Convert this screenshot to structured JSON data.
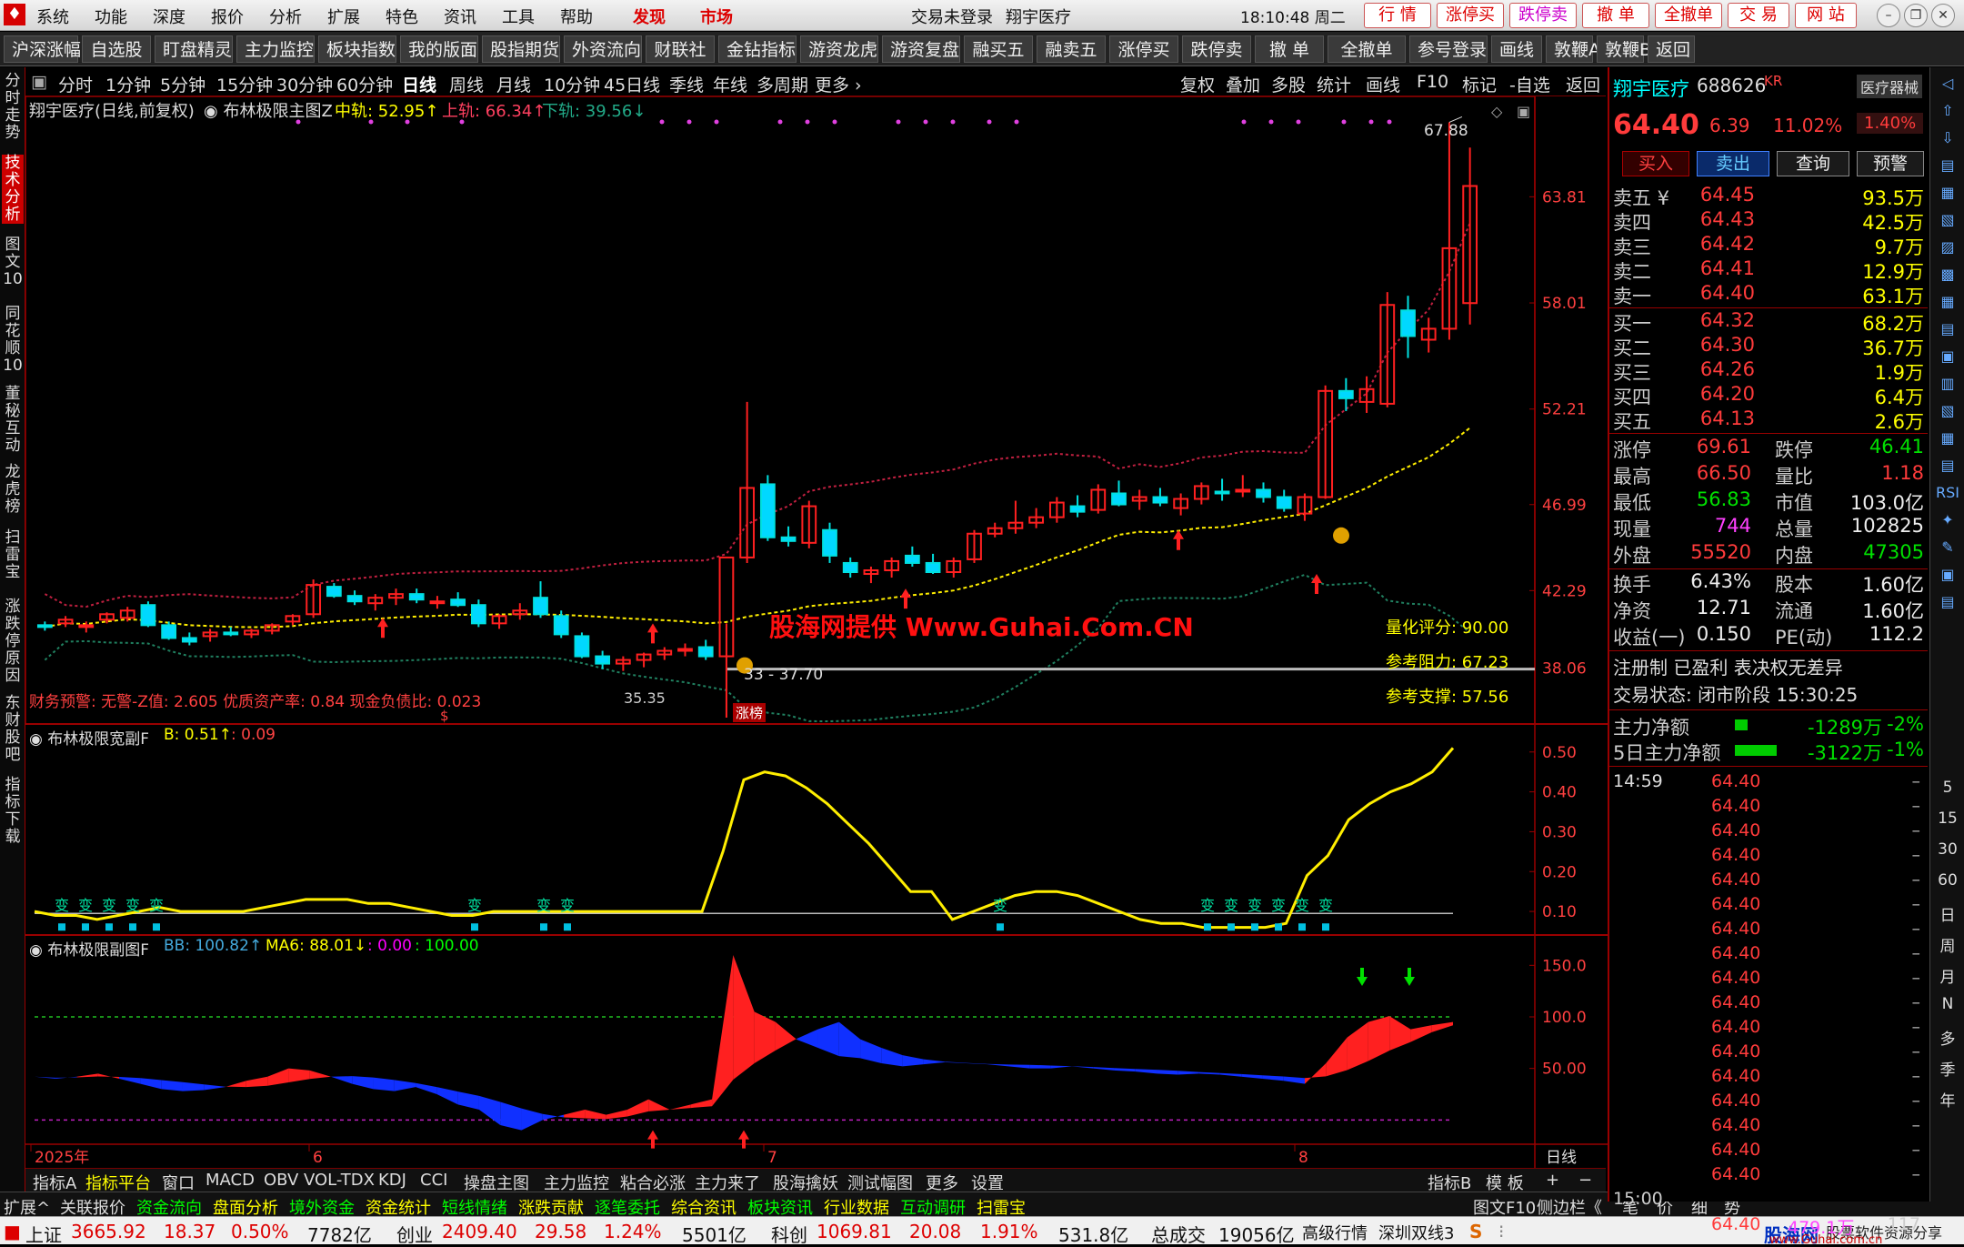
{
  "topbar": {
    "menus": [
      "系统",
      "功能",
      "深度",
      "报价",
      "分析",
      "扩展",
      "特色",
      "资讯",
      "工具",
      "帮助"
    ],
    "discover": "发现",
    "market": "市场",
    "login_status": "交易未登录",
    "stock_name": "翔宇医疗",
    "clock": "18:10:48 周二",
    "buttons": [
      "行 情",
      "涨停买",
      "跌停卖",
      "撤 单",
      "全撤单",
      "交 易",
      "网 站"
    ]
  },
  "toolbar": [
    "沪深涨幅",
    "自选股",
    "盯盘精灵",
    "主力监控",
    "板块指数",
    "我的版面",
    "股指期货",
    "外资流向",
    "财联社",
    "金钻指标",
    "游资龙虎",
    "游资复盘",
    "融买五",
    "融卖五",
    "涨停买",
    "跌停卖",
    "撤 单",
    "全撤单",
    "参号登录",
    "画线",
    "敦鞭A",
    "敦鞭B",
    "返回"
  ],
  "left_tabs": [
    "分时走势",
    "技术分析",
    "图文10",
    "同花顺10",
    "董秘互动",
    "龙虎榜",
    "扫雷宝",
    "涨跌停原因",
    "东财股吧",
    "指标下载"
  ],
  "periods": [
    "分时",
    "1分钟",
    "5分钟",
    "15分钟",
    "30分钟",
    "60分钟",
    "日线",
    "周线",
    "月线",
    "10分钟",
    "45日线",
    "季线",
    "年线",
    "多周期",
    "更多 ›"
  ],
  "active_period": "日线",
  "period_right": [
    "复权",
    "叠加",
    "多股",
    "统计",
    "画线",
    "F10",
    "标记",
    "-自选",
    "返回"
  ],
  "main_chart": {
    "title": "翔宇医疗(日线,前复权)",
    "indicator": "布林极限主图Z",
    "mid_label": "中轨: 52.95↑",
    "upper_label": "上轨: 66.34↑",
    "lower_label": "下轨: 39.56↓",
    "y_ticks": [
      "63.81",
      "58.01",
      "52.21",
      "46.99",
      "42.29",
      "38.06"
    ],
    "annot_high": "67.88",
    "annot_low": "35.35",
    "annot_range": "33 - 37.70",
    "zhangting": "涨榜",
    "watermark": "股海网提供 Www.Guhai.Com.CN",
    "score": "量化评分: 90.00",
    "resistance": "参考阻力: 67.23",
    "support": "参考支撑: 57.56",
    "finance_warning": "财务预警: 无警-Z值: 2.605 优质资产率: 0.84 现金负债比: 0.023",
    "dollar": "$"
  },
  "sub1": {
    "title": "布林极限宽副F",
    "b_label": "B: 0.51↑",
    "extra": ": 0.09",
    "y_ticks": [
      "0.50",
      "0.40",
      "0.30",
      "0.20",
      "0.10"
    ],
    "tag": "变"
  },
  "sub2": {
    "title": "布林极限副图F",
    "bb_label": "BB: 100.82↑",
    "ma6_label": "MA6: 88.01↓",
    "extra1": ": 0.00",
    "extra2": ": 100.00",
    "y_ticks": [
      "150.0",
      "100.0",
      "50.00"
    ]
  },
  "x_axis": {
    "labels": [
      "2025年",
      "6",
      "7",
      "8"
    ],
    "right": "日线"
  },
  "bottom_tabs": [
    "指标A",
    "指标平台",
    "窗口",
    "MACD",
    "OBV",
    "VOL-TDX",
    "KDJ",
    "CCI",
    "操盘主图",
    "主力监控",
    "粘合必涨",
    "主力来了",
    "股海擒妖",
    "测试幅图",
    "更多",
    "设置"
  ],
  "bottom_right": [
    "指标B",
    "模 板",
    "+",
    "−"
  ],
  "status_row1": [
    "扩展^",
    "关联报价",
    "资金流向",
    "盘面分析",
    "境外资金",
    "资金统计",
    "短线情绪",
    "涨跌贡献",
    "逐笔委托",
    "综合资讯",
    "板块资讯",
    "行业数据",
    "互动调研",
    "扫雷宝"
  ],
  "status_row1_right": [
    "图文F10",
    "侧边栏《",
    "笔",
    "价",
    "细",
    "势"
  ],
  "status_row2": {
    "sh_label": "上证",
    "sh_val": "3665.92",
    "sh_chg": "18.37",
    "sh_pct": "0.50%",
    "sh_amt": "7782亿",
    "cy_label": "创业",
    "cy_val": "2409.40",
    "cy_chg": "29.58",
    "cy_pct": "1.24%",
    "cy_amt": "5501亿",
    "kc_label": "科创",
    "kc_val": "1069.81",
    "kc_chg": "20.08",
    "kc_pct": "1.91%",
    "kc_amt": "531.8亿",
    "total_label": "总成交",
    "total_val": "19056亿",
    "hq": "高级行情",
    "sz": "深圳双线3",
    "site": "股海网",
    "site_desc": "股票软件资源分享",
    "site_url": "www.Guhai.com.cn"
  },
  "quote": {
    "name": "翔宇医疗",
    "code": "688626",
    "flag": "KR",
    "sector": "医疗器械",
    "price": "64.40",
    "chg": "6.39",
    "pct": "11.02%",
    "sector_pct": "1.40%",
    "actions": [
      "买入",
      "卖出",
      "查询",
      "预警"
    ],
    "sells": [
      [
        "卖五 ¥",
        "64.45",
        "93.5万"
      ],
      [
        "卖四",
        "64.43",
        "42.5万"
      ],
      [
        "卖三",
        "64.42",
        "9.7万"
      ],
      [
        "卖二",
        "64.41",
        "12.9万"
      ],
      [
        "卖一",
        "64.40",
        "63.1万"
      ]
    ],
    "buys": [
      [
        "买一",
        "64.32",
        "68.2万"
      ],
      [
        "买二",
        "64.30",
        "36.7万"
      ],
      [
        "买三",
        "64.26",
        "1.9万"
      ],
      [
        "买四",
        "64.20",
        "6.4万"
      ],
      [
        "买五",
        "64.13",
        "2.6万"
      ]
    ],
    "stats": [
      [
        "涨停",
        "69.61",
        "跌停",
        "46.41"
      ],
      [
        "最高",
        "66.50",
        "量比",
        "1.18"
      ],
      [
        "最低",
        "56.83",
        "市值",
        "103.0亿"
      ],
      [
        "现量",
        "744",
        "总量",
        "102825"
      ],
      [
        "外盘",
        "55520",
        "内盘",
        "47305"
      ],
      [
        "换手",
        "6.43%",
        "股本",
        "1.60亿"
      ],
      [
        "净资",
        "12.71",
        "流通",
        "1.60亿"
      ],
      [
        "收益(一)",
        "0.150",
        "PE(动)",
        "112.2"
      ]
    ],
    "reg": "注册制 已盈利 表决权无差异",
    "trade_state": "交易状态: 闭市阶段 15:30:25",
    "main_net_label": "主力净额",
    "main_net": "-1289万",
    "main_net_pct": "-2%",
    "main5_label": "5日主力净额",
    "main5": "-3122万",
    "main5_pct": "-1%",
    "ticks_start": "14:59",
    "tick_price": "64.40",
    "ticks_end": "15:00",
    "last_vol": "479.1万",
    "last_num": "117"
  },
  "right_side": [
    "5",
    "15",
    "30",
    "60",
    "日",
    "周",
    "月",
    "N",
    "多",
    "季",
    "年"
  ],
  "chart_data": {
    "type": "candlestick",
    "title": "翔宇医疗(日线,前复权)",
    "x_labels": [
      "2025年",
      "6",
      "7",
      "8"
    ],
    "ohlc": [
      [
        40.4,
        40.6,
        40.1,
        40.3
      ],
      [
        40.5,
        40.9,
        40.3,
        40.7
      ],
      [
        40.3,
        40.6,
        40.0,
        40.4
      ],
      [
        40.7,
        41.1,
        40.5,
        41.0
      ],
      [
        40.8,
        41.4,
        40.6,
        41.2
      ],
      [
        41.5,
        41.7,
        40.3,
        40.4
      ],
      [
        40.4,
        40.6,
        39.6,
        39.7
      ],
      [
        39.7,
        40.0,
        39.3,
        39.5
      ],
      [
        39.8,
        40.2,
        39.5,
        40.0
      ],
      [
        40.0,
        40.3,
        39.8,
        39.9
      ],
      [
        39.9,
        40.2,
        39.7,
        40.1
      ],
      [
        40.1,
        40.5,
        39.9,
        40.4
      ],
      [
        40.6,
        41.0,
        40.4,
        40.9
      ],
      [
        41.0,
        42.9,
        40.8,
        42.6
      ],
      [
        42.5,
        42.7,
        41.9,
        42.0
      ],
      [
        42.0,
        42.3,
        41.5,
        41.7
      ],
      [
        41.6,
        42.1,
        41.2,
        41.9
      ],
      [
        41.9,
        42.4,
        41.5,
        42.1
      ],
      [
        42.1,
        42.4,
        41.6,
        41.8
      ],
      [
        41.6,
        42.0,
        41.3,
        41.7
      ],
      [
        41.8,
        42.2,
        41.4,
        41.5
      ],
      [
        41.5,
        41.8,
        40.3,
        40.5
      ],
      [
        40.5,
        41.0,
        40.2,
        40.9
      ],
      [
        41.0,
        41.6,
        40.7,
        41.2
      ],
      [
        41.9,
        42.8,
        40.8,
        41.0
      ],
      [
        40.9,
        41.2,
        39.7,
        39.9
      ],
      [
        39.8,
        40.0,
        38.6,
        38.7
      ],
      [
        38.7,
        39.0,
        38.0,
        38.3
      ],
      [
        38.3,
        38.7,
        37.9,
        38.5
      ],
      [
        38.5,
        38.9,
        38.1,
        38.8
      ],
      [
        38.8,
        39.2,
        38.5,
        39.0
      ],
      [
        39.0,
        39.4,
        38.7,
        39.1
      ],
      [
        39.2,
        39.6,
        38.5,
        38.7
      ],
      [
        38.7,
        40.5,
        35.35,
        44.1
      ],
      [
        44.1,
        52.6,
        43.8,
        47.9
      ],
      [
        48.1,
        48.6,
        45.0,
        45.2
      ],
      [
        45.2,
        45.8,
        44.7,
        45.0
      ],
      [
        44.9,
        47.2,
        44.6,
        46.9
      ],
      [
        45.6,
        46.0,
        43.8,
        44.2
      ],
      [
        43.8,
        44.1,
        43.0,
        43.3
      ],
      [
        43.2,
        43.6,
        42.7,
        43.4
      ],
      [
        43.4,
        44.1,
        43.0,
        43.9
      ],
      [
        44.2,
        44.7,
        43.6,
        43.8
      ],
      [
        43.8,
        44.3,
        43.2,
        43.3
      ],
      [
        43.3,
        44.1,
        43.0,
        43.9
      ],
      [
        44.0,
        45.6,
        43.8,
        45.4
      ],
      [
        45.4,
        46.0,
        45.2,
        45.7
      ],
      [
        45.7,
        47.2,
        45.4,
        46.0
      ],
      [
        46.0,
        46.8,
        45.7,
        46.3
      ],
      [
        46.3,
        47.4,
        46.0,
        47.1
      ],
      [
        46.9,
        47.5,
        46.3,
        46.6
      ],
      [
        46.7,
        48.1,
        46.5,
        47.8
      ],
      [
        47.6,
        48.3,
        46.9,
        47.0
      ],
      [
        47.2,
        47.8,
        46.7,
        47.4
      ],
      [
        47.4,
        47.9,
        46.9,
        47.1
      ],
      [
        46.8,
        47.6,
        46.4,
        47.3
      ],
      [
        47.3,
        48.2,
        47.0,
        48.0
      ],
      [
        47.7,
        48.4,
        47.2,
        47.6
      ],
      [
        47.7,
        48.6,
        47.4,
        47.8
      ],
      [
        47.8,
        48.2,
        47.1,
        47.4
      ],
      [
        47.4,
        47.8,
        46.6,
        46.8
      ],
      [
        46.5,
        47.6,
        46.1,
        47.4
      ],
      [
        47.4,
        53.5,
        47.3,
        53.2
      ],
      [
        53.2,
        53.9,
        52.1,
        52.8
      ],
      [
        52.6,
        54.0,
        52.0,
        53.3
      ],
      [
        52.5,
        58.6,
        52.3,
        57.9
      ],
      [
        57.6,
        58.4,
        55.0,
        56.2
      ],
      [
        56.0,
        57.2,
        55.3,
        56.6
      ],
      [
        56.6,
        67.88,
        56.0,
        61.0
      ],
      [
        58.0,
        66.5,
        56.83,
        64.4
      ]
    ],
    "bands": {
      "mid": 52.95,
      "upper": 66.34,
      "lower": 39.56
    },
    "sub1_B": [
      0.1,
      0.09,
      0.09,
      0.08,
      0.09,
      0.1,
      0.11,
      0.1,
      0.1,
      0.1,
      0.1,
      0.11,
      0.12,
      0.13,
      0.13,
      0.13,
      0.12,
      0.12,
      0.11,
      0.1,
      0.09,
      0.09,
      0.1,
      0.1,
      0.1,
      0.1,
      0.1,
      0.1,
      0.1,
      0.1,
      0.1,
      0.1,
      0.1,
      0.25,
      0.43,
      0.45,
      0.44,
      0.41,
      0.37,
      0.32,
      0.27,
      0.21,
      0.15,
      0.15,
      0.08,
      0.1,
      0.12,
      0.14,
      0.15,
      0.15,
      0.14,
      0.12,
      0.1,
      0.08,
      0.07,
      0.07,
      0.06,
      0.06,
      0.06,
      0.06,
      0.07,
      0.19,
      0.24,
      0.33,
      0.37,
      0.4,
      0.42,
      0.45,
      0.51
    ],
    "sub2_BB": [
      42,
      40,
      42,
      45,
      40,
      35,
      30,
      28,
      29,
      32,
      38,
      42,
      50,
      48,
      42,
      35,
      30,
      28,
      32,
      25,
      15,
      10,
      -5,
      -10,
      0,
      5,
      10,
      5,
      10,
      20,
      10,
      15,
      20,
      160,
      105,
      95,
      78,
      70,
      62,
      60,
      55,
      52,
      54,
      56,
      55,
      54,
      52,
      50,
      50,
      52,
      50,
      48,
      47,
      45,
      44,
      45,
      44,
      42,
      40,
      38,
      35,
      55,
      80,
      95,
      100.82,
      88,
      92,
      95
    ]
  }
}
